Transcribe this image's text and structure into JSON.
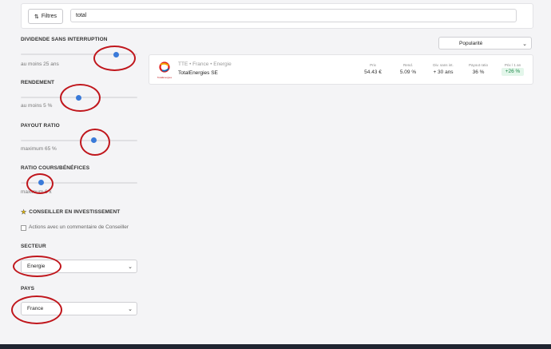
{
  "topbar": {
    "filters_label": "Filtres",
    "search_value": "total"
  },
  "sort": {
    "selected": "Popularité"
  },
  "filters": {
    "dividende": {
      "title": "DIVIDENDE SANS INTERRUPTION",
      "subtitle": "au moins 25 ans"
    },
    "rendement": {
      "title": "RENDEMENT",
      "subtitle": "au moins 5 %"
    },
    "payout": {
      "title": "PAYOUT RATIO",
      "subtitle": "maximum 65 %"
    },
    "per": {
      "title": "RATIO COURS/BÉNÉFICES",
      "subtitle": "maximum 6 x"
    },
    "conseiller": {
      "title": "CONSEILLER EN INVESTISSEMENT",
      "checkbox_label": "Actions avec un commentaire de Conseiller"
    },
    "secteur": {
      "title": "SECTEUR",
      "selected": "Energie"
    },
    "pays": {
      "title": "PAYS",
      "selected": "France"
    }
  },
  "result": {
    "meta": "TTE • France • Energie",
    "name": "TotalEnergies SE",
    "logo_text": "TotalEnergies",
    "columns": [
      {
        "header": "Prix",
        "value": "54.43 €"
      },
      {
        "header": "Rend.",
        "value": "5.09 %"
      },
      {
        "header": "Div. sans int.",
        "value": "+ 30 ans"
      },
      {
        "header": "Payout ratio",
        "value": "36 %"
      },
      {
        "header": "Prix / 1 an",
        "value": "+26 %"
      }
    ]
  },
  "colors": {
    "accent": "#3a7ad9",
    "annotation": "#c0161c",
    "positive_bg": "#e3f6ea",
    "positive_text": "#1f8a4c"
  }
}
